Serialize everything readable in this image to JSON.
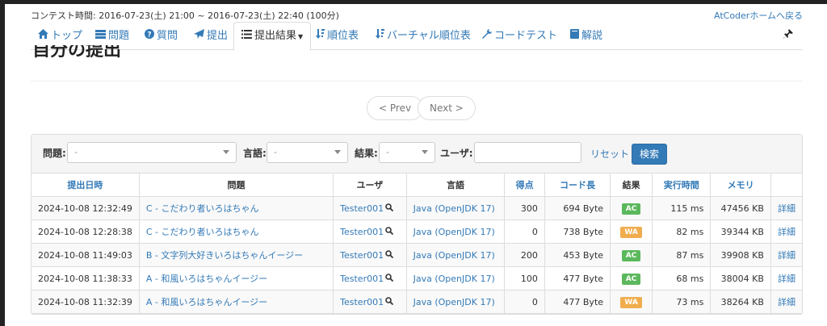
{
  "header": {
    "contest_time": "コンテスト時間: 2016-07-23(土) 21:00 ~ 2016-07-23(土) 22:40 (100分)",
    "home_link": "AtCoderホームへ戻る"
  },
  "nav": {
    "items": [
      {
        "label": "トップ",
        "icon": "home-icon"
      },
      {
        "label": "問題",
        "icon": "list-icon"
      },
      {
        "label": "質問",
        "icon": "question-icon"
      },
      {
        "label": "提出",
        "icon": "send-icon"
      },
      {
        "label": "提出結果",
        "icon": "list-icon",
        "active": true
      },
      {
        "label": "順位表",
        "icon": "sort-icon"
      },
      {
        "label": "バーチャル順位表",
        "icon": "sort-icon"
      },
      {
        "label": "コードテスト",
        "icon": "wrench-icon"
      },
      {
        "label": "解説",
        "icon": "book-icon"
      }
    ]
  },
  "page": {
    "title": "自分の提出"
  },
  "pager": {
    "prev": "< Prev",
    "next": "Next >"
  },
  "filters": {
    "problem_label": "問題:",
    "problem_value": "-",
    "language_label": "言語:",
    "language_value": "-",
    "result_label": "結果:",
    "result_value": "-",
    "user_label": "ユーザ:",
    "user_value": "",
    "reset": "リセット",
    "search": "検索"
  },
  "table": {
    "headers": [
      "提出日時",
      "問題",
      "ユーザ",
      "言語",
      "得点",
      "コード長",
      "結果",
      "実行時間",
      "メモリ",
      ""
    ],
    "rows": [
      {
        "time": "2024-10-08 12:32:49",
        "problem": "C - こだわり者いろはちゃん",
        "user": "Tester001",
        "lang": "Java (OpenJDK 17)",
        "score": "300",
        "code": "694 Byte",
        "result": "AC",
        "exec": "115 ms",
        "mem": "47456 KB",
        "detail": "詳細"
      },
      {
        "time": "2024-10-08 12:28:38",
        "problem": "C - こだわり者いろはちゃん",
        "user": "Tester001",
        "lang": "Java (OpenJDK 17)",
        "score": "0",
        "code": "738 Byte",
        "result": "WA",
        "exec": "82 ms",
        "mem": "39344 KB",
        "detail": "詳細"
      },
      {
        "time": "2024-10-08 11:49:03",
        "problem": "B - 文字列大好きいろはちゃんイージー",
        "user": "Tester001",
        "lang": "Java (OpenJDK 17)",
        "score": "200",
        "code": "453 Byte",
        "result": "AC",
        "exec": "87 ms",
        "mem": "39908 KB",
        "detail": "詳細"
      },
      {
        "time": "2024-10-08 11:38:33",
        "problem": "A - 和風いろはちゃんイージー",
        "user": "Tester001",
        "lang": "Java (OpenJDK 17)",
        "score": "100",
        "code": "477 Byte",
        "result": "AC",
        "exec": "68 ms",
        "mem": "38004 KB",
        "detail": "詳細"
      },
      {
        "time": "2024-10-08 11:32:39",
        "problem": "A - 和風いろはちゃんイージー",
        "user": "Tester001",
        "lang": "Java (OpenJDK 17)",
        "score": "0",
        "code": "477 Byte",
        "result": "WA",
        "exec": "73 ms",
        "mem": "38264 KB",
        "detail": "詳細"
      }
    ]
  },
  "colors": {
    "link": "#337ab7",
    "ac": "#5cb85c",
    "wa": "#f0ad4e"
  }
}
